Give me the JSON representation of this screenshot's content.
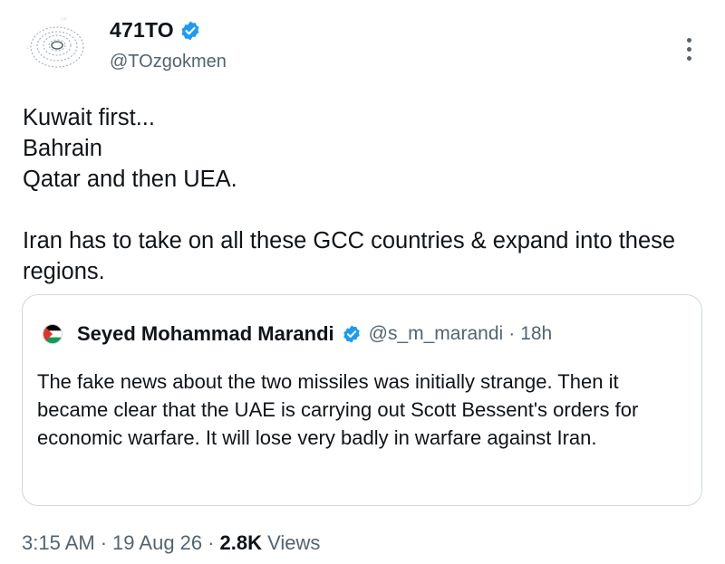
{
  "author": {
    "display_name": "471TO",
    "handle": "@TOzgokmen"
  },
  "tweet": {
    "lines": [
      "Kuwait first...",
      "Bahrain",
      "Qatar and then UEA."
    ],
    "paragraph2": "Iran has to take on all these GCC countries & expand into these regions."
  },
  "quote": {
    "display_name": "Seyed Mohammad Marandi",
    "handle": "@s_m_marandi",
    "separator": "·",
    "time": "18h",
    "text": "The fake news about the two missiles was initially strange. Then it became clear that the UAE is carrying out Scott Bessent's orders for economic warfare. It will lose very badly in warfare against Iran."
  },
  "meta": {
    "time": "3:15 AM",
    "dot1": "·",
    "date": "19 Aug 26",
    "dot2": "·",
    "views_count": "2.8K",
    "views_label": "Views"
  },
  "icons": {
    "verified": "verified-badge-icon",
    "more": "more-options-icon",
    "quote_avatar": "palestine-flag-icon"
  },
  "colors": {
    "verified_blue": "#1d9bf0",
    "secondary_text": "#536471",
    "border": "#cfd9de"
  }
}
